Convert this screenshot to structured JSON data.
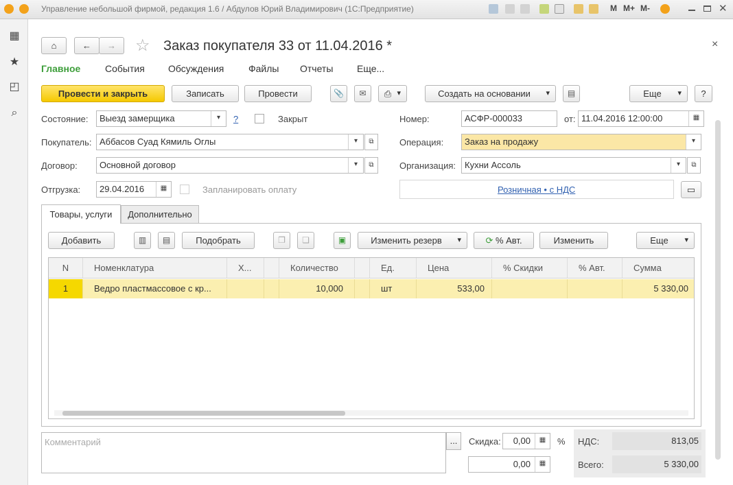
{
  "window": {
    "title": "Управление небольшой фирмой, редакция 1.6 / Абдулов Юрий Владимирович  (1С:Предприятие)",
    "mem_buttons": [
      "M",
      "M+",
      "M-"
    ]
  },
  "form": {
    "title": "Заказ покупателя 33 от 11.04.2016 *",
    "close": "×",
    "nav": [
      "Главное",
      "События",
      "Обсуждения",
      "Файлы",
      "Отчеты",
      "Еще..."
    ],
    "toolbar": {
      "post_close": "Провести и закрыть",
      "save": "Записать",
      "post": "Провести",
      "create_based": "Создать на основании",
      "more": "Еще",
      "help": "?"
    },
    "state": {
      "label": "Состояние:",
      "value": "Выезд замерщика",
      "hint": "?"
    },
    "closed": {
      "label": "Закрыт"
    },
    "number": {
      "label": "Номер:",
      "value": "АСФР-000033",
      "from_label": "от:",
      "date": "11.04.2016 12:00:00"
    },
    "buyer": {
      "label": "Покупатель:",
      "value": "Аббасов Суад Кямиль Оглы"
    },
    "operation": {
      "label": "Операция:",
      "value": "Заказ на продажу"
    },
    "contract": {
      "label": "Договор:",
      "value": "Основной договор"
    },
    "organization": {
      "label": "Организация:",
      "value": "Кухни Ассоль"
    },
    "shipment": {
      "label": "Отгрузка:",
      "date": "29.04.2016",
      "plan_payment": "Запланировать оплату"
    },
    "price_type": "Розничная • с НДС",
    "tabs": [
      "Товары, услуги",
      "Дополнительно"
    ],
    "table_toolbar": {
      "add": "Добавить",
      "pick": "Подобрать",
      "change_reserve": "Изменить резерв",
      "auto_pct": "% Авт.",
      "change": "Изменить",
      "more": "Еще"
    },
    "table": {
      "columns": [
        "N",
        "Номенклатура",
        "Х...",
        "Количество",
        "Ед.",
        "Цена",
        "% Скидки",
        "% Авт.",
        "Сумма"
      ],
      "rows": [
        {
          "n": "1",
          "item": "Ведро пластмассовое с кр...",
          "char": "",
          "qty": "10,000",
          "unit": "шт",
          "price": "533,00",
          "disc": "",
          "auto": "",
          "sum": "5 330,00"
        }
      ]
    },
    "footer": {
      "comment_placeholder": "Комментарий",
      "comment_btn": "...",
      "discount_label": "Скидка:",
      "discount_value": "0,00",
      "discount_unit": "%",
      "discount_sum": "0,00",
      "vat_label": "НДС:",
      "vat_value": "813,05",
      "total_label": "Всего:",
      "total_value": "5 330,00"
    }
  },
  "colors": {
    "accent_green": "#3d9e3a",
    "yellow_button": "#f5c900",
    "selected_row": "#fbefb0",
    "operation_highlight": "#fbe7a6"
  }
}
